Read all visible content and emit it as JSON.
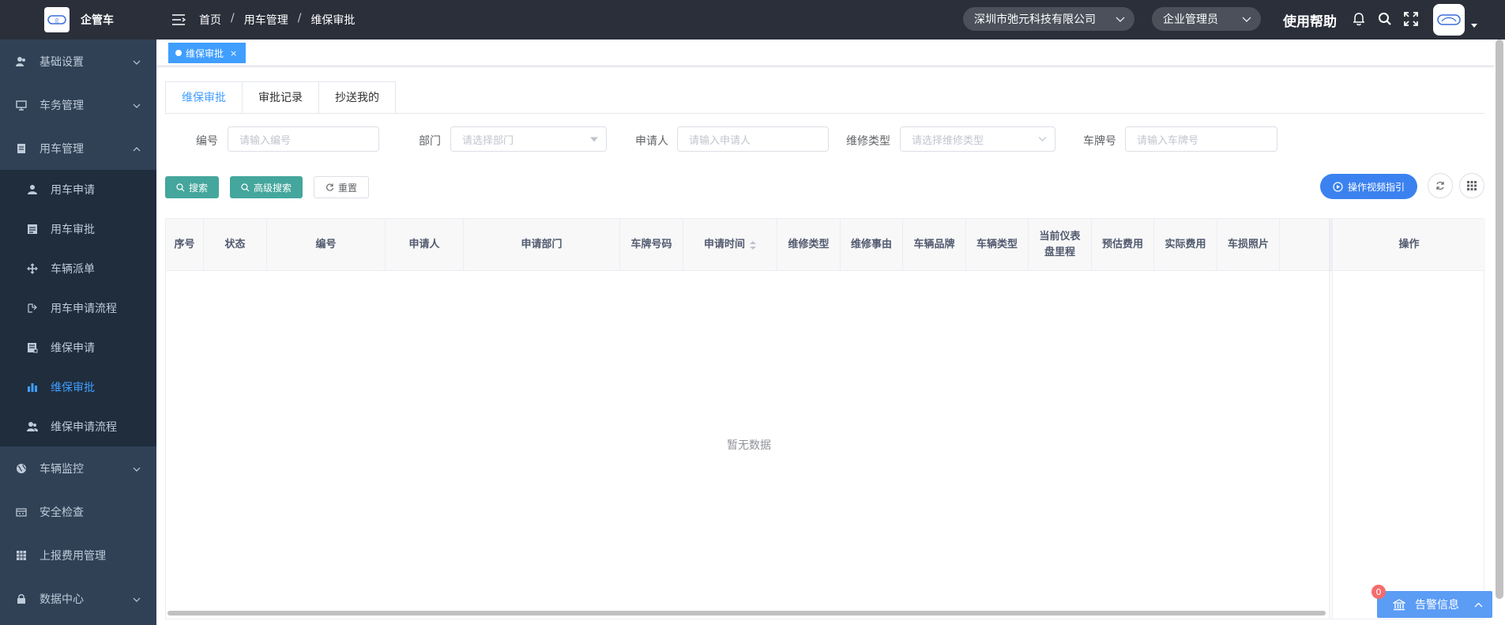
{
  "app": {
    "logo_text": "企管车",
    "colors": {
      "sidebar_bg": "#304156",
      "header_bg": "#2b2f3a",
      "accent": "#409eff",
      "teal": "#44a69c"
    }
  },
  "sidebar": {
    "menu": [
      {
        "label": "基础设置",
        "icon": "user-group-icon",
        "expandable": true
      },
      {
        "label": "车务管理",
        "icon": "monitor-icon",
        "expandable": true
      },
      {
        "label": "用车管理",
        "icon": "document-icon",
        "expandable": true,
        "expanded": true
      }
    ],
    "submenu": [
      {
        "label": "用车申请",
        "icon": "user-icon"
      },
      {
        "label": "用车审批",
        "icon": "list-doc-icon"
      },
      {
        "label": "车辆派单",
        "icon": "move-icon"
      },
      {
        "label": "用车申请流程",
        "icon": "flow-icon"
      },
      {
        "label": "维保申请",
        "icon": "form-icon"
      },
      {
        "label": "维保审批",
        "icon": "bar-chart-icon",
        "active": true
      },
      {
        "label": "维保申请流程",
        "icon": "peoples-icon"
      }
    ],
    "menu_bottom": [
      {
        "label": "车辆监控",
        "icon": "globe-icon",
        "expandable": true
      },
      {
        "label": "安全检查",
        "icon": "calendar-icon",
        "expandable": false
      },
      {
        "label": "上报费用管理",
        "icon": "grid-icon",
        "expandable": false
      },
      {
        "label": "数据中心",
        "icon": "lock-icon",
        "expandable": true
      }
    ]
  },
  "header": {
    "breadcrumb": [
      "首页",
      "用车管理",
      "维保审批"
    ],
    "company": "深圳市弛元科技有限公司",
    "role": "企业管理员",
    "help": "使用帮助"
  },
  "tagsview": {
    "active_tag": "维保审批",
    "close": "×"
  },
  "tabs": [
    {
      "label": "维保审批",
      "active": true
    },
    {
      "label": "审批记录",
      "active": false
    },
    {
      "label": "抄送我的",
      "active": false
    }
  ],
  "filters": {
    "code": {
      "label": "编号",
      "placeholder": "请输入编号"
    },
    "dept": {
      "label": "部门",
      "placeholder": "请选择部门"
    },
    "applicant": {
      "label": "申请人",
      "placeholder": "请输入申请人"
    },
    "repair_type": {
      "label": "维修类型",
      "placeholder": "请选择维修类型"
    },
    "plate": {
      "label": "车牌号",
      "placeholder": "请输入车牌号"
    }
  },
  "buttons": {
    "search": "搜索",
    "advanced": "高级搜索",
    "reset": "重置",
    "guide": "操作视频指引"
  },
  "table": {
    "columns": [
      {
        "label": "序号",
        "sortable": false
      },
      {
        "label": "状态",
        "sortable": false
      },
      {
        "label": "编号",
        "sortable": false
      },
      {
        "label": "申请人",
        "sortable": false
      },
      {
        "label": "申请部门",
        "sortable": false
      },
      {
        "label": "车牌号码",
        "sortable": false
      },
      {
        "label": "申请时间",
        "sortable": true
      },
      {
        "label": "维修类型",
        "sortable": false
      },
      {
        "label": "维修事由",
        "sortable": false
      },
      {
        "label": "车辆品牌",
        "sortable": false
      },
      {
        "label": "车辆类型",
        "sortable": false
      },
      {
        "label": "当前仪表",
        "sortable": false
      },
      {
        "label": "预估费用",
        "sortable": false
      },
      {
        "label": "实际费用",
        "sortable": false
      },
      {
        "label": "车损照片",
        "sortable": false
      },
      {
        "label": "",
        "sortable": false
      }
    ],
    "col_odometer_line2": "盘里程",
    "action_column": "操作",
    "empty_text": "暂无数据",
    "rows": []
  },
  "alert": {
    "label": "告警信息",
    "badge": "0"
  }
}
